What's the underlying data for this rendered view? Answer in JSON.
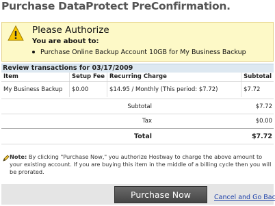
{
  "page": {
    "title": "Purchase DataProtect PreConfirmation."
  },
  "alert": {
    "icon": "warning-icon",
    "title": "Please Authorize",
    "subtitle": "You are about to:",
    "items": [
      "Purchase Online Backup Account 10GB for My Business Backup"
    ]
  },
  "review": {
    "label": "Review transactions for 03/17/2009"
  },
  "table": {
    "headers": [
      "Item",
      "Setup Fee",
      "Recurring Charge",
      "Subtotal"
    ],
    "rows": [
      [
        "My Business Backup",
        "$0.00",
        "$14.95 / Monthly (This period: $7.72)",
        "$7.72"
      ]
    ]
  },
  "summary": {
    "subtotal_label": "Subtotal",
    "subtotal_value": "$7.72",
    "tax_label": "Tax",
    "tax_value": "$0.00",
    "total_label": "Total",
    "total_value": "$7.72"
  },
  "note": {
    "label": "Note:",
    "text": "By clicking \"Purchase Now,\" you authorize Hostway to charge the above amount to your existing account. If you are buying this item in the middle of a billing cycle then you will be prorated."
  },
  "actions": {
    "purchase_label": "Purchase Now",
    "cancel_label": "Cancel and Go Back"
  }
}
